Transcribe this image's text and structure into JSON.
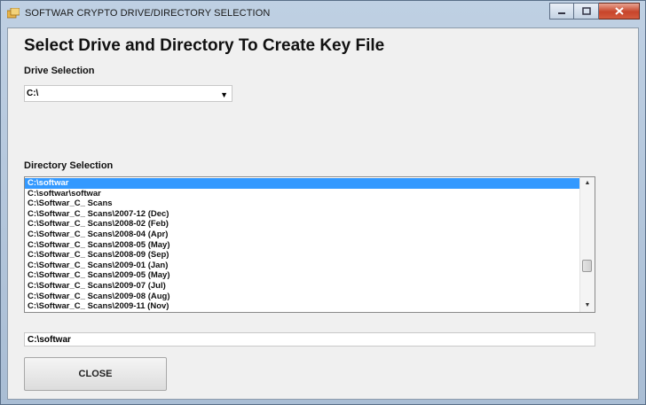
{
  "window": {
    "title": "SOFTWAR CRYPTO DRIVE/DIRECTORY SELECTION",
    "close_color": "#c7452b"
  },
  "form": {
    "heading": "Select Drive and Directory To Create Key File",
    "drive_label": "Drive Selection",
    "drive_value": "C:\\",
    "directory_label": "Directory Selection",
    "directories": [
      "C:\\softwar",
      "C:\\softwar\\softwar",
      "C:\\Softwar_C_ Scans",
      "C:\\Softwar_C_ Scans\\2007-12 (Dec)",
      "C:\\Softwar_C_ Scans\\2008-02 (Feb)",
      "C:\\Softwar_C_ Scans\\2008-04 (Apr)",
      "C:\\Softwar_C_ Scans\\2008-05 (May)",
      "C:\\Softwar_C_ Scans\\2008-09 (Sep)",
      "C:\\Softwar_C_ Scans\\2009-01 (Jan)",
      "C:\\Softwar_C_ Scans\\2009-05 (May)",
      "C:\\Softwar_C_ Scans\\2009-07 (Jul)",
      "C:\\Softwar_C_ Scans\\2009-08 (Aug)",
      "C:\\Softwar_C_ Scans\\2009-11 (Nov)"
    ],
    "selected_index": 0,
    "selection_color": "#3399ff",
    "selected_path": "C:\\softwar",
    "close_label": "CLOSE"
  }
}
